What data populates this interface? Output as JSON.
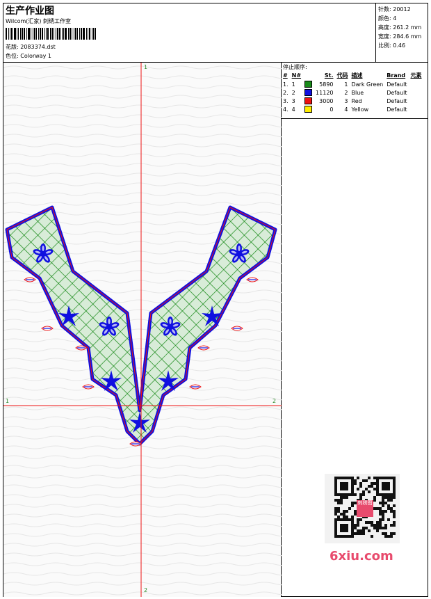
{
  "header": {
    "title": "生产作业图",
    "subtitle": "Wilcom(汇家) 刺绣工作室",
    "design_label": "花版:",
    "design_value": "2083374.dst",
    "colorway_label": "色位:",
    "colorway_value": "Colorway 1"
  },
  "specs": [
    {
      "label": "针数:",
      "value": "20012"
    },
    {
      "label": "颜色:",
      "value": "4"
    },
    {
      "label": "高度:",
      "value": "261.2 mm"
    },
    {
      "label": "宽度:",
      "value": "284.6 mm"
    },
    {
      "label": "比例:",
      "value": "0.46"
    }
  ],
  "stop_sequence": {
    "title": "停止顺序:",
    "headers": [
      "#",
      "N#",
      "",
      "St.",
      "代码",
      "描述",
      "Brand",
      "元素"
    ],
    "rows": [
      {
        "num": "1.",
        "n": "1",
        "color": "#1a8a1a",
        "st": "5890",
        "code": "1",
        "desc": "Dark Green",
        "brand": "Default"
      },
      {
        "num": "2.",
        "n": "2",
        "color": "#1010e0",
        "st": "11120",
        "code": "2",
        "desc": "Blue",
        "brand": "Default"
      },
      {
        "num": "3.",
        "n": "3",
        "color": "#ee1111",
        "st": "3000",
        "code": "3",
        "desc": "Red",
        "brand": "Default"
      },
      {
        "num": "4.",
        "n": "4",
        "color": "#ffee00",
        "st": "0",
        "code": "4",
        "desc": "Yellow",
        "brand": "Default"
      }
    ]
  },
  "axis_labels": {
    "top": "1",
    "bottom": "2",
    "left": "1",
    "right": "2"
  },
  "watermark": {
    "text": "6xiu.com",
    "seal": "刺绣图"
  }
}
